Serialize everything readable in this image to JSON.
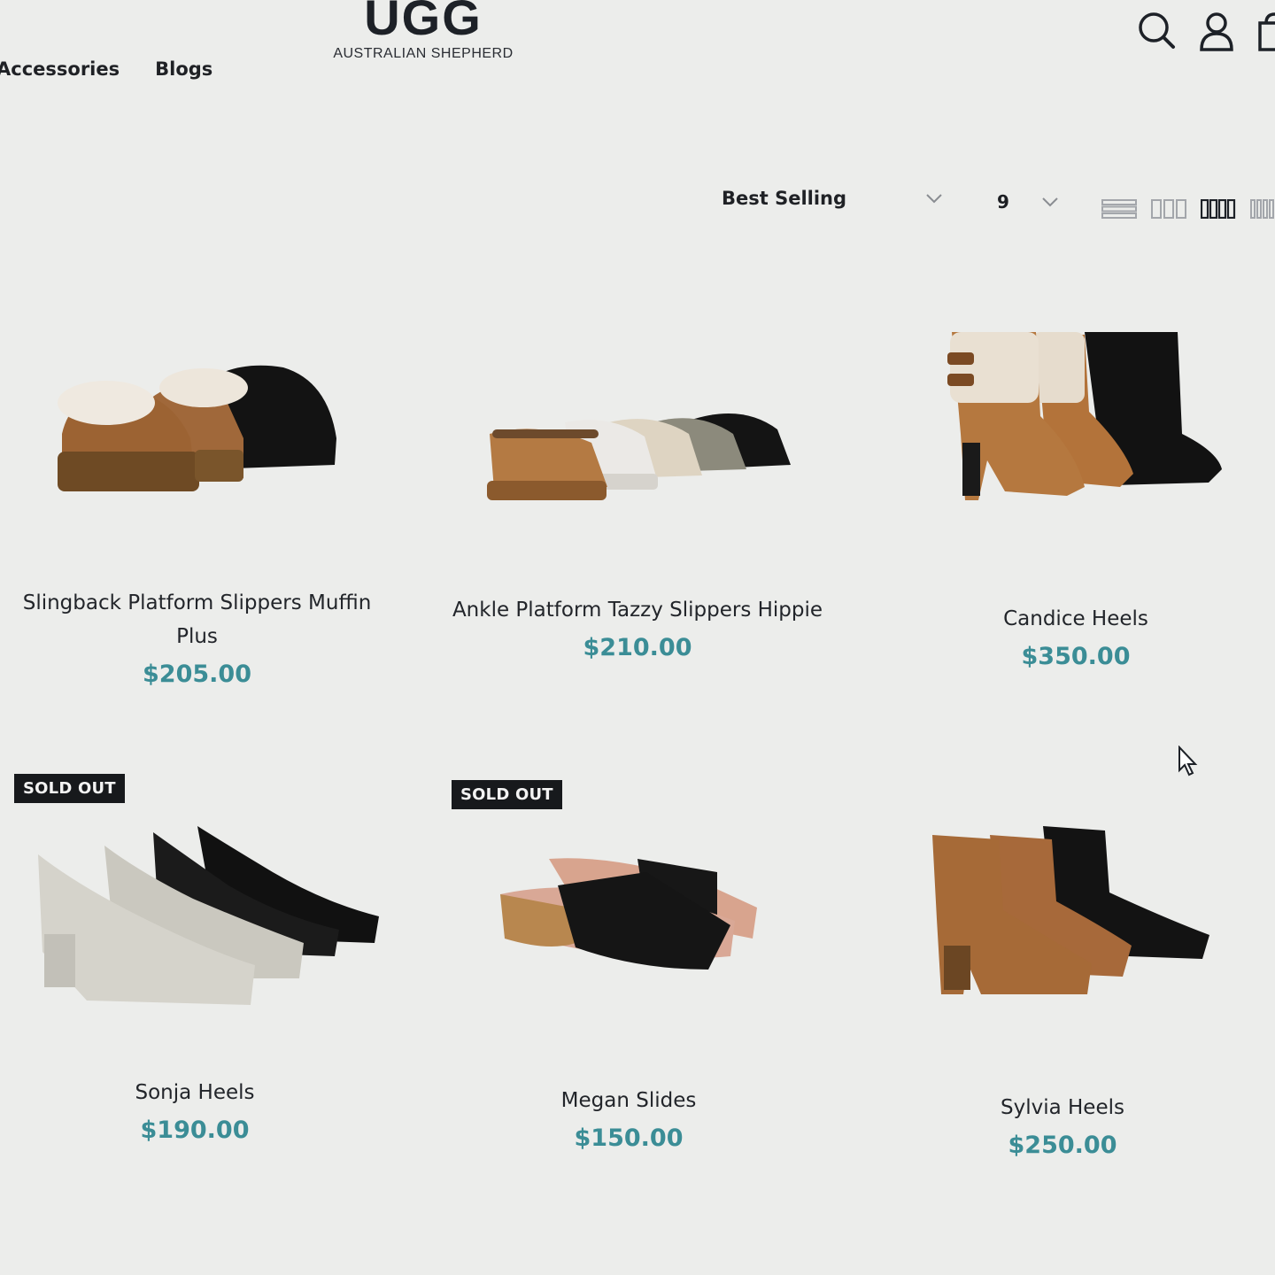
{
  "header": {
    "logo_main": "UGG",
    "logo_sub": "AUSTRALIAN SHEPHERD",
    "nav": [
      "Accessories",
      "Blogs"
    ],
    "icons": [
      "search-icon",
      "account-icon",
      "cart-icon"
    ]
  },
  "toolbar": {
    "sort_label": "Best Selling",
    "per_page": "9",
    "view_modes": [
      "list-view-icon",
      "grid-3-icon",
      "grid-4-icon",
      "grid-5-icon"
    ],
    "active_view": "grid-4-icon"
  },
  "products": [
    {
      "title": "Slingback Platform Slippers Muffin Plus",
      "price": "$205.00",
      "badge": ""
    },
    {
      "title": "Ankle Platform Tazzy Slippers Hippie",
      "price": "$210.00",
      "badge": ""
    },
    {
      "title": "Candice Heels",
      "price": "$350.00",
      "badge": ""
    },
    {
      "title": "Sonja Heels",
      "price": "$190.00",
      "badge": "SOLD OUT"
    },
    {
      "title": "Megan Slides",
      "price": "$150.00",
      "badge": "SOLD OUT"
    },
    {
      "title": "Sylvia Heels",
      "price": "$250.00",
      "badge": ""
    }
  ],
  "colors": {
    "background": "#ecedeb",
    "price": "#3b8d96",
    "badge": "#17191c",
    "text": "#1c1e22"
  }
}
